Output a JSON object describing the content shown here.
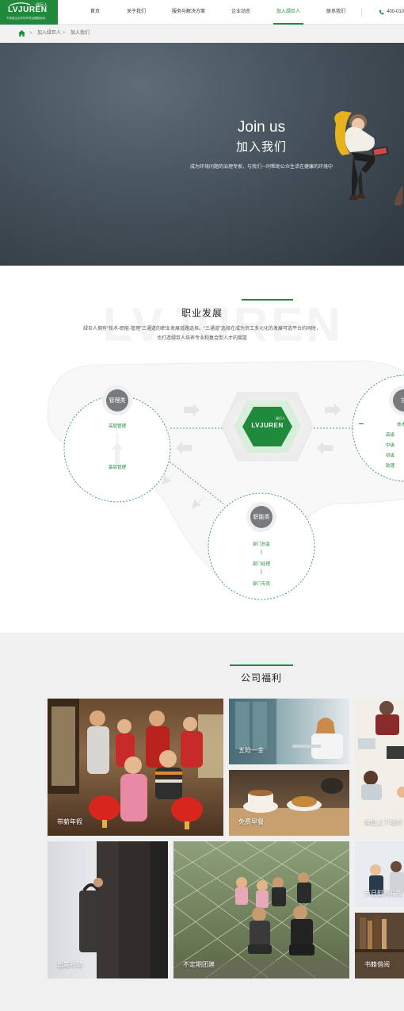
{
  "brand": {
    "logo_text": "LVJUREN",
    "logo_cn": "绿巨人",
    "tagline": "千家政企合作的环境治理服务商"
  },
  "nav": {
    "items": [
      {
        "label": "首页"
      },
      {
        "label": "关于我们"
      },
      {
        "label": "服务与解决方案"
      },
      {
        "label": "企业动态"
      },
      {
        "label": "加入绿巨人"
      },
      {
        "label": "联系我们"
      }
    ],
    "active_index": 4,
    "phone": "400-010"
  },
  "breadcrumb": {
    "items": [
      "加入绿巨人",
      "加入我们"
    ],
    "separator": ">"
  },
  "hero": {
    "title_en": "Join us",
    "title_cn": "加入我们",
    "subtitle": "成为环境问题的治理专家，与我们一同帮助公众生活在健康的环境中"
  },
  "career": {
    "title": "职业发展",
    "desc_line1": "绿巨人拥有“技术-职能-管理”三通道的职业发展道路选择。“三通道”选择在成为员工多元化的发展可选平台的同时，",
    "desc_line2": "也打造绿巨人培养专业和复合型人才的摇篮",
    "center_logo": "LVJUREN",
    "center_logo_cn": "绿巨人",
    "management": {
      "title": "管理类",
      "levels": [
        "高层管理",
        "基层管理"
      ]
    },
    "function": {
      "title": "职能类",
      "levels": [
        "部门总监",
        "部门经理",
        "部门专员"
      ]
    },
    "technical": {
      "title": "技术类",
      "levels": [
        "技术",
        "高级",
        "中级",
        "初级",
        "助理"
      ]
    }
  },
  "welfare": {
    "title": "公司福利",
    "tiles": [
      {
        "label": "带薪年假"
      },
      {
        "label": "五险一金"
      },
      {
        "label": "免费早餐"
      },
      {
        "label": "弹性上下班时"
      },
      {
        "label": "出差补助"
      },
      {
        "label": "不定期团建"
      },
      {
        "label": "节日慰问礼物"
      },
      {
        "label": "书籍借阅"
      }
    ]
  },
  "colors": {
    "brand_green": "#1f8a3c",
    "hero_dark": "#2d363e",
    "node_gray": "#7a7e82"
  }
}
